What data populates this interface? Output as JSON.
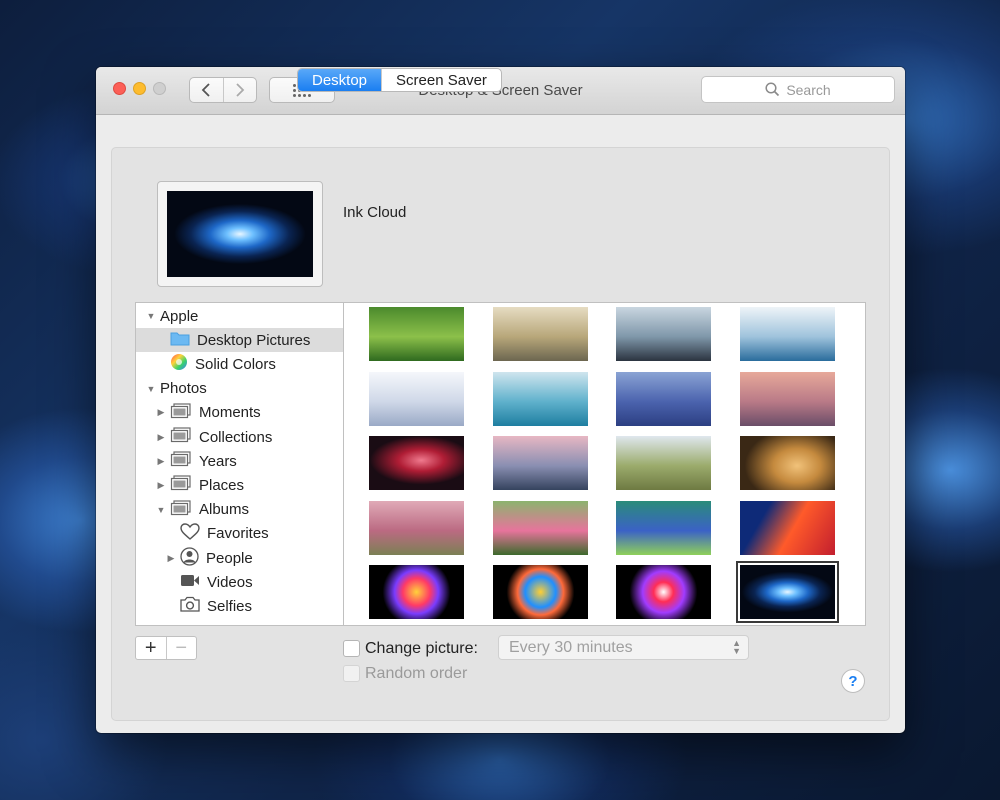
{
  "window": {
    "title": "Desktop & Screen Saver",
    "search_placeholder": "Search"
  },
  "tabs": [
    {
      "label": "Desktop",
      "active": true
    },
    {
      "label": "Screen Saver",
      "active": false
    }
  ],
  "current_picture": {
    "name": "Ink Cloud"
  },
  "sidebar": {
    "items": [
      {
        "label": "Apple",
        "level": 0,
        "disclosure": "open",
        "icon": "none"
      },
      {
        "label": "Desktop Pictures",
        "level": 1,
        "disclosure": "none",
        "icon": "folder-icon",
        "selected": true
      },
      {
        "label": "Solid Colors",
        "level": 1,
        "disclosure": "none",
        "icon": "color-wheel-icon"
      },
      {
        "label": "Photos",
        "level": 0,
        "disclosure": "open",
        "icon": "none"
      },
      {
        "label": "Moments",
        "level": 1,
        "disclosure": "closed",
        "icon": "album-stack-icon"
      },
      {
        "label": "Collections",
        "level": 1,
        "disclosure": "closed",
        "icon": "album-stack-icon"
      },
      {
        "label": "Years",
        "level": 1,
        "disclosure": "closed",
        "icon": "album-stack-icon"
      },
      {
        "label": "Places",
        "level": 1,
        "disclosure": "closed",
        "icon": "album-stack-icon"
      },
      {
        "label": "Albums",
        "level": 1,
        "disclosure": "open",
        "icon": "album-stack-icon"
      },
      {
        "label": "Favorites",
        "level": 2,
        "disclosure": "none",
        "icon": "heart-icon"
      },
      {
        "label": "People",
        "level": 2,
        "disclosure": "closed",
        "icon": "person-icon"
      },
      {
        "label": "Videos",
        "level": 2,
        "disclosure": "none",
        "icon": "video-camera-icon"
      },
      {
        "label": "Selfies",
        "level": 2,
        "disclosure": "none",
        "icon": "camera-icon"
      }
    ]
  },
  "wallpapers": [
    {
      "name": "green-fields",
      "colors": [
        "#4b8a2c",
        "#8cc04a",
        "#2f6a1f"
      ]
    },
    {
      "name": "foggy-forest",
      "colors": [
        "#e6dcc2",
        "#b8a77a",
        "#6c6650"
      ]
    },
    {
      "name": "misty-mountains",
      "colors": [
        "#c9d6e0",
        "#7f97aa",
        "#2b3440"
      ]
    },
    {
      "name": "ice-floes",
      "colors": [
        "#eef4f8",
        "#9fc3dc",
        "#2a6c9c"
      ]
    },
    {
      "name": "snow-drifts",
      "colors": [
        "#f5f7fb",
        "#cfd8e8",
        "#9aa9c6"
      ]
    },
    {
      "name": "blue-pond",
      "colors": [
        "#cfe5ee",
        "#5fb1cc",
        "#1e7ea0"
      ]
    },
    {
      "name": "blue-glacier",
      "colors": [
        "#8aa3d4",
        "#4b63ae",
        "#2c3f82"
      ]
    },
    {
      "name": "pink-dunes",
      "colors": [
        "#e7a99a",
        "#b97a87",
        "#6a4d68"
      ]
    },
    {
      "name": "red-canyon",
      "colors": [
        "#1a0c14",
        "#b01d35",
        "#f07a8e"
      ]
    },
    {
      "name": "pink-lake",
      "colors": [
        "#e7b7c3",
        "#8a8fb2",
        "#35435e"
      ]
    },
    {
      "name": "elephant-savanna",
      "colors": [
        "#dfe7ee",
        "#9bab6c",
        "#6e7a42"
      ]
    },
    {
      "name": "lion",
      "colors": [
        "#3a2815",
        "#c58a3e",
        "#f1c27a"
      ]
    },
    {
      "name": "pink-grass",
      "colors": [
        "#e0aab7",
        "#bb6a82",
        "#7b8054"
      ]
    },
    {
      "name": "poppies",
      "colors": [
        "#8cb36e",
        "#e7749c",
        "#3c6a2c"
      ]
    },
    {
      "name": "green-aerial",
      "colors": [
        "#2a8c7a",
        "#3b62c6",
        "#8fd05a"
      ]
    },
    {
      "name": "orange-feathers",
      "colors": [
        "#0e2a78",
        "#ff5a2a",
        "#c21e2e"
      ]
    },
    {
      "name": "color-burst-1",
      "colors": [
        "#000000",
        "#ff3a66",
        "#ffd23a"
      ]
    },
    {
      "name": "color-burst-2",
      "colors": [
        "#000000",
        "#1f8fff",
        "#ffcf33"
      ]
    },
    {
      "name": "color-burst-3",
      "colors": [
        "#000000",
        "#a13cff",
        "#ff2d55"
      ]
    },
    {
      "name": "ink-cloud",
      "colors": [
        "#030814",
        "#1e68c8",
        "#e8f6ff"
      ],
      "selected": true
    }
  ],
  "controls": {
    "add_label": "+",
    "remove_label": "−",
    "change_picture_label": "Change picture:",
    "change_picture_checked": false,
    "interval_value": "Every 30 minutes",
    "random_order_label": "Random order",
    "random_order_checked": false,
    "help_label": "?"
  }
}
